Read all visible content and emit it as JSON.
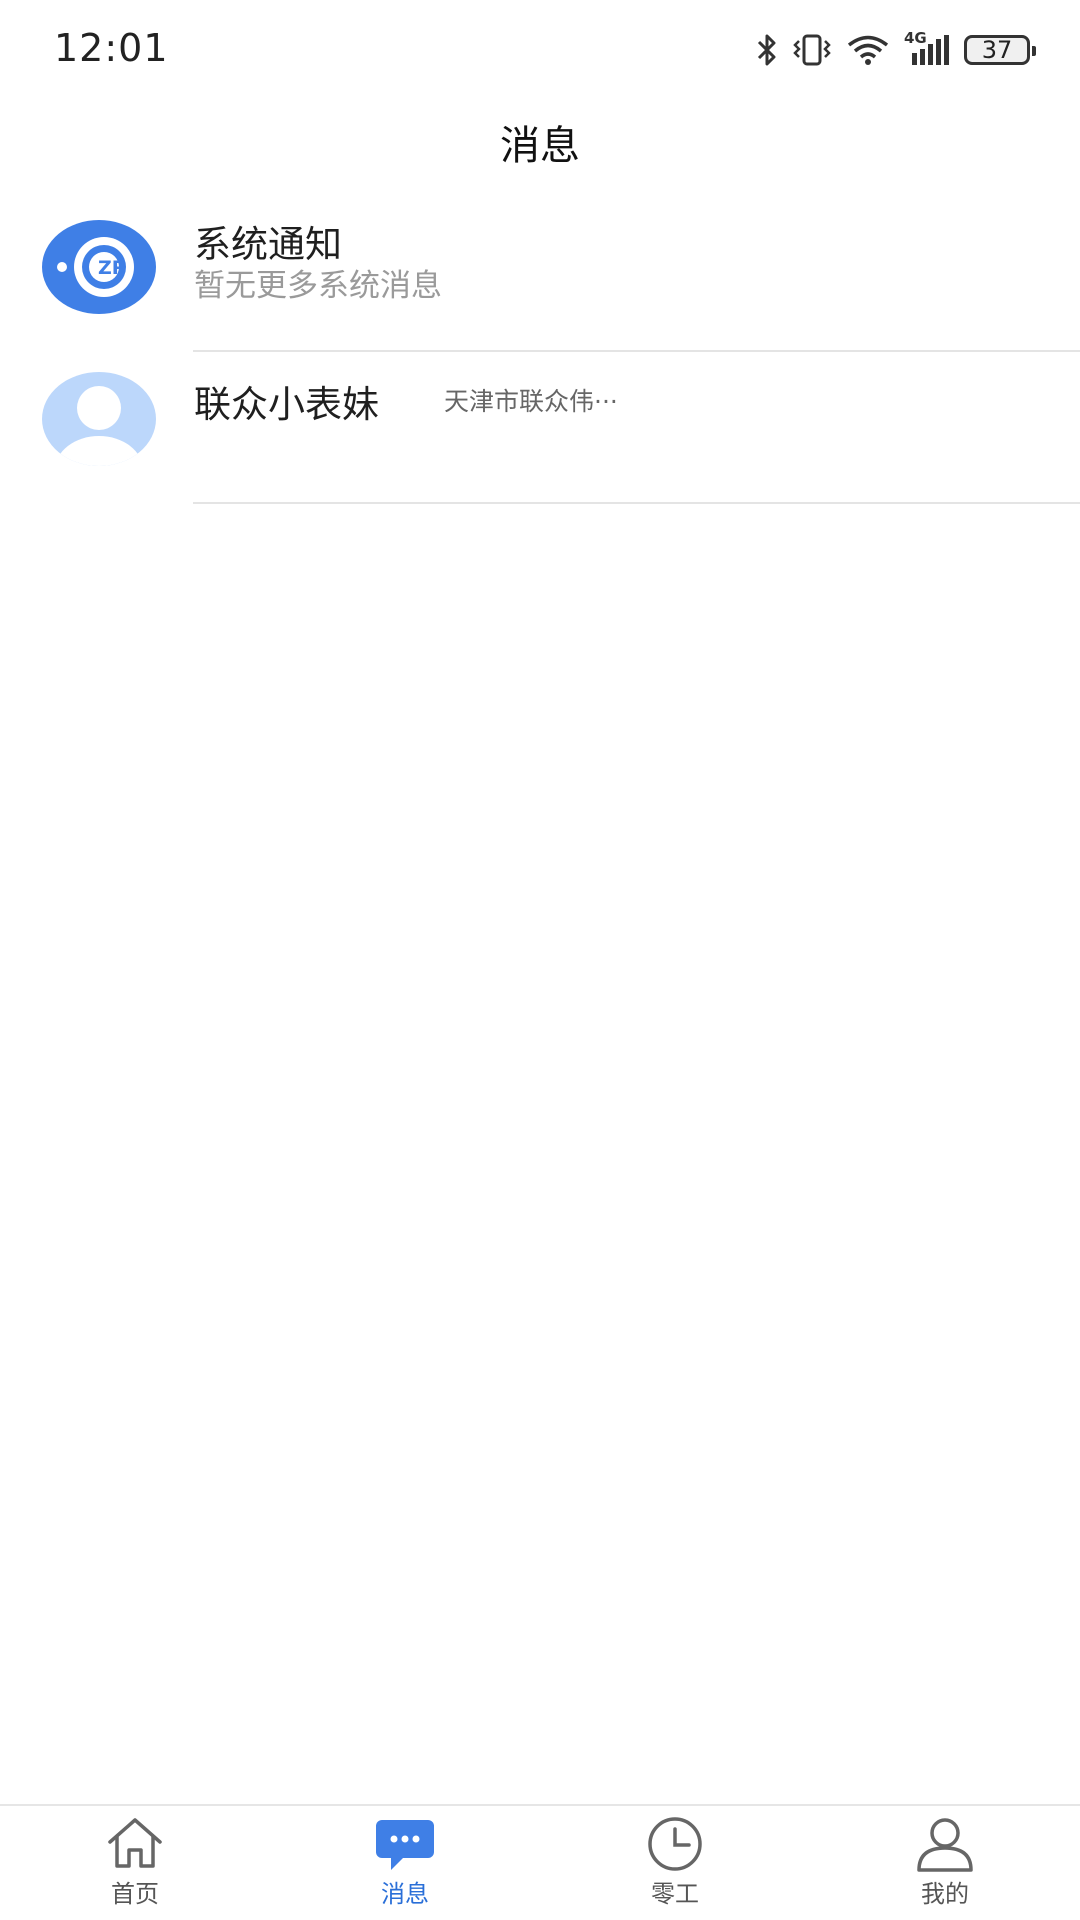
{
  "status_bar": {
    "time": "12:01",
    "battery": "37",
    "network": "4G"
  },
  "header": {
    "title": "消息"
  },
  "messages": [
    {
      "title": "系统通知",
      "subtitle": "暂无更多系统消息",
      "avatar_icon": "system-notice-icon",
      "accent_color": "#3f7fe6"
    },
    {
      "title": "联众小表妹",
      "preview": "天津市联众伟···",
      "avatar_icon": "default-user-avatar",
      "accent_color": "#bcd7fb"
    }
  ],
  "bottom_nav": {
    "active_color": "#2a6fd8",
    "items": [
      {
        "label": "首页",
        "icon": "home-icon"
      },
      {
        "label": "消息",
        "icon": "chat-bubble-icon"
      },
      {
        "label": "零工",
        "icon": "clock-icon"
      },
      {
        "label": "我的",
        "icon": "person-icon"
      }
    ]
  }
}
